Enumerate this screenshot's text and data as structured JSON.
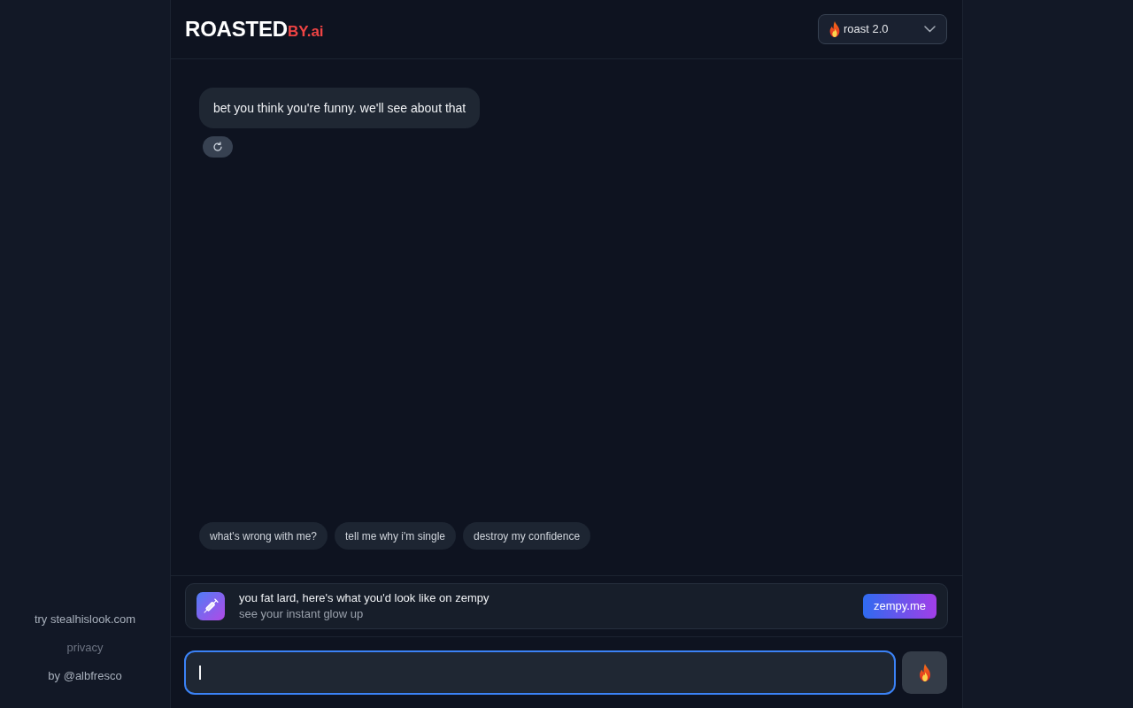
{
  "sidebar": {
    "links": [
      {
        "text": "try stealhislook.com",
        "muted": false
      },
      {
        "text": "privacy",
        "muted": true
      },
      {
        "text": "by @albfresco",
        "muted": false
      }
    ]
  },
  "header": {
    "logo": {
      "wordmark": "ROASTED",
      "suffix": "BY.ai"
    },
    "model_select": {
      "value": "roast 2.0"
    }
  },
  "messages": [
    {
      "kind": "bot",
      "text": "bet you think you're funny. we'll see about that"
    }
  ],
  "suggestions": [
    "what's wrong with me?",
    "tell me why i'm single",
    "destroy my confidence"
  ],
  "promo": {
    "title": "you fat lard, here's what you'd look like on zempy",
    "subtitle": "see your instant glow up",
    "button": "zempy.me"
  },
  "composer": {
    "focused": true
  }
}
